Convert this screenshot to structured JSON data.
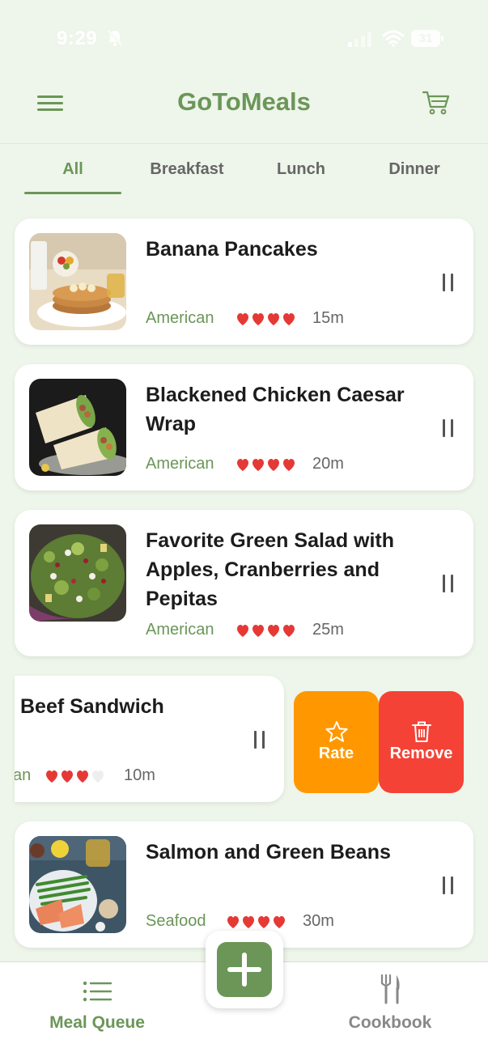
{
  "status_bar": {
    "time": "9:29",
    "battery": "31"
  },
  "header": {
    "title": "GoToMeals"
  },
  "tabs": [
    {
      "label": "All"
    },
    {
      "label": "Breakfast"
    },
    {
      "label": "Lunch"
    },
    {
      "label": "Dinner"
    }
  ],
  "meals": [
    {
      "name": "Banana Pancakes",
      "cuisine": "American",
      "rating": 4,
      "time": "15m"
    },
    {
      "name": "Blackened Chicken Caesar Wrap",
      "cuisine": "American",
      "rating": 4,
      "time": "20m"
    },
    {
      "name": "Favorite Green Salad with Apples, Cranberries and Pepitas",
      "cuisine": "American",
      "rating": 4,
      "time": "25m"
    },
    {
      "name": "Beef Sandwich",
      "cuisine": "an",
      "rating": 3,
      "time": "10m"
    },
    {
      "name": "Salmon and Green Beans",
      "cuisine": "Seafood",
      "rating": 4,
      "time": "30m"
    }
  ],
  "swipe_actions": {
    "rate_label": "Rate",
    "remove_label": "Remove"
  },
  "bottom_nav": {
    "meal_queue_label": "Meal Queue",
    "cookbook_label": "Cookbook"
  },
  "colors": {
    "accent": "#6b9658",
    "background": "#eef5ea",
    "heart": "#e53935",
    "rate": "#ff9800",
    "remove": "#f44336"
  },
  "icons": [
    "bell-slash-icon",
    "signal-icon",
    "wifi-icon",
    "battery-icon",
    "menu-icon",
    "cart-icon",
    "heart-icon",
    "drag-handle-icon",
    "star-icon",
    "trash-icon",
    "list-icon",
    "fork-knife-icon",
    "plus-icon"
  ]
}
